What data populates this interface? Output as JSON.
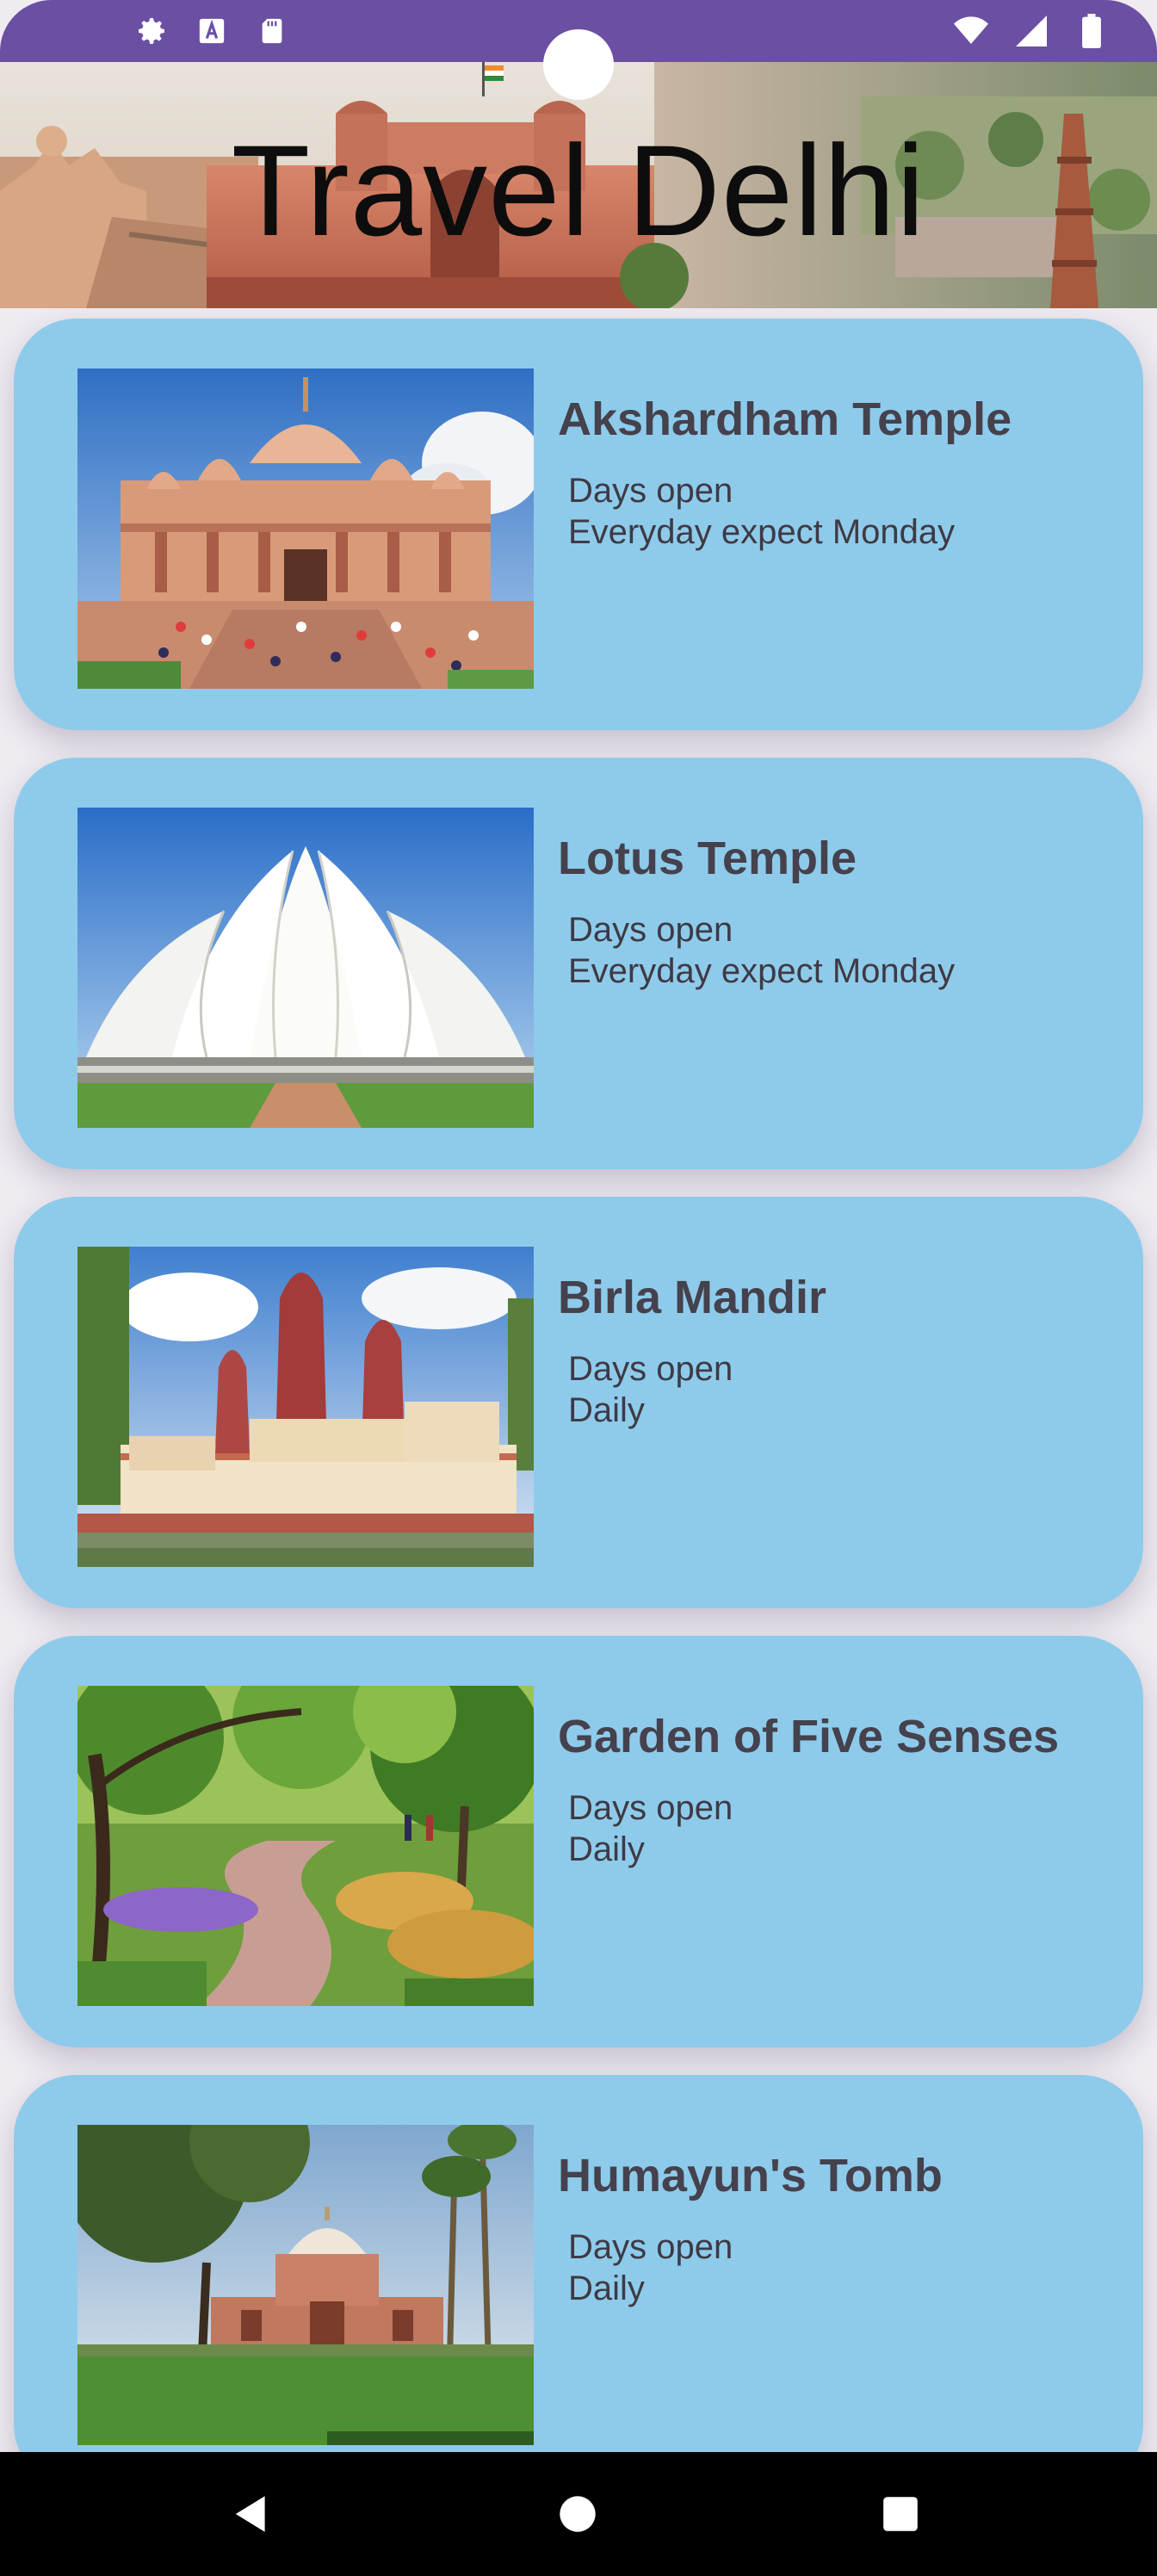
{
  "status_bar": {
    "left_icons": [
      "gear-icon",
      "font-a-icon",
      "sd-card-icon"
    ],
    "right_icons": [
      "wifi-icon",
      "signal-icon",
      "battery-icon"
    ],
    "color": "#6a4fa3"
  },
  "header": {
    "title": "Travel Delhi"
  },
  "places": [
    {
      "title": "Akshardham Temple",
      "days_label": "Days open",
      "days_value": "Everyday expect Monday",
      "image": "akshardham-photo"
    },
    {
      "title": "Lotus Temple",
      "days_label": "Days open",
      "days_value": "Everyday expect Monday",
      "image": "lotus-temple-photo"
    },
    {
      "title": "Birla Mandir",
      "days_label": "Days open",
      "days_value": "Daily",
      "image": "birla-mandir-photo"
    },
    {
      "title": "Garden of Five Senses",
      "days_label": "Days open",
      "days_value": "Daily",
      "image": "garden-photo"
    },
    {
      "title": "Humayun's Tomb",
      "days_label": "Days open",
      "days_value": "Daily",
      "image": "humayun-tomb-photo"
    }
  ],
  "nav_bar": {
    "buttons": [
      "back-icon",
      "home-icon",
      "recents-icon"
    ]
  },
  "colors": {
    "card_background": "#8ecbeb",
    "title_text": "#45414d",
    "page_background": "#efebf1"
  }
}
